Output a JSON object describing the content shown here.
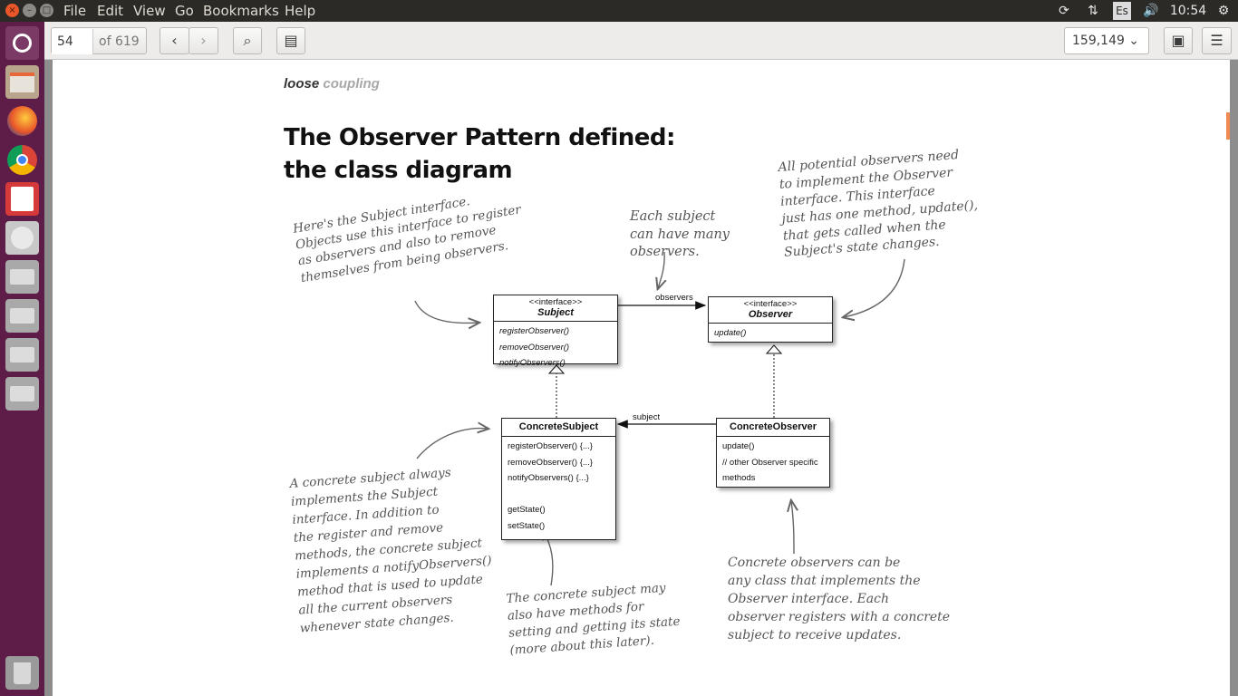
{
  "menubar": {
    "items": [
      "File",
      "Edit",
      "View",
      "Go",
      "Bookmarks",
      "Help"
    ],
    "keyboard_layout": "Es",
    "clock": "10:54"
  },
  "toolbar": {
    "page_number": "54",
    "page_total": "of 619",
    "zoom": "159,149"
  },
  "page": {
    "running_head_bold": "loose",
    "running_head_light": "coupling",
    "title_line1": "The Observer Pattern defined:",
    "title_line2": "the class diagram"
  },
  "diagram": {
    "subject": {
      "stereotype": "<<interface>>",
      "name": "Subject",
      "methods": [
        "registerObserver()",
        "removeObserver()",
        "notifyObservers()"
      ]
    },
    "observer": {
      "stereotype": "<<interface>>",
      "name": "Observer",
      "methods": [
        "update()"
      ]
    },
    "concrete_subject": {
      "name": "ConcreteSubject",
      "methods": [
        "registerObserver() {...}",
        "removeObserver() {...}",
        "notifyObservers() {...}",
        "",
        "getState()",
        "setState()"
      ]
    },
    "concrete_observer": {
      "name": "ConcreteObserver",
      "methods": [
        "update()",
        "// other Observer specific",
        "methods"
      ]
    },
    "assoc_observers": "observers",
    "assoc_subject": "subject"
  },
  "annotations": {
    "subject_note": [
      "Here's the Subject interface.",
      "Objects use this interface to register",
      "as observers and also to remove",
      "themselves from being observers."
    ],
    "many_note": [
      "Each subject",
      "can have many",
      "observers."
    ],
    "observer_note": [
      "All potential observers need",
      "to implement the Observer",
      "interface.  This interface",
      "just has one method, update(),",
      "that gets called when the",
      "Subject's state changes."
    ],
    "concrete_subject_note": [
      "A concrete subject always",
      "implements the Subject",
      "interface.  In addition to",
      "the register and remove",
      "methods, the concrete subject",
      "implements a notifyObservers()",
      "method that is used to update",
      "all the current observers",
      "whenever state changes."
    ],
    "state_note": [
      "The concrete subject may",
      "also have methods for",
      "setting and getting its state",
      "(more about this later)."
    ],
    "concrete_observer_note": [
      "Concrete observers can be",
      "any class that implements the",
      "Observer interface.  Each",
      "observer registers with a concrete",
      "subject to receive updates."
    ]
  }
}
